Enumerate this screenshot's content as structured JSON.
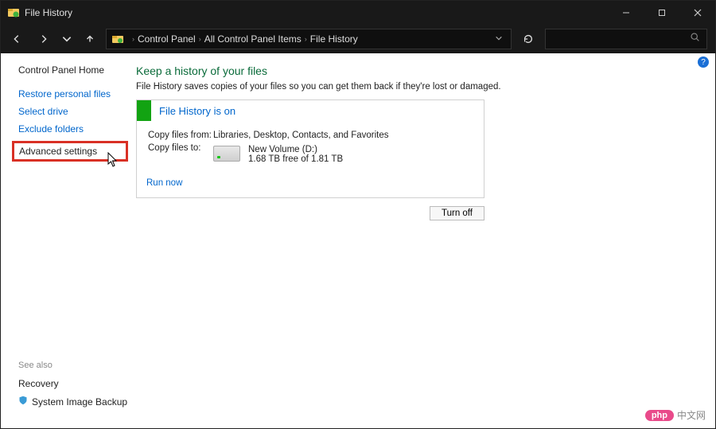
{
  "titlebar": {
    "title": "File History"
  },
  "nav": {
    "crumbs": {
      "a": "Control Panel",
      "b": "All Control Panel Items",
      "c": "File History"
    }
  },
  "sidebar": {
    "home": "Control Panel Home",
    "links": {
      "restore": "Restore personal files",
      "select_drive": "Select drive",
      "exclude": "Exclude folders",
      "advanced": "Advanced settings"
    },
    "seealso": {
      "header": "See also",
      "recovery": "Recovery",
      "sib": "System Image Backup"
    }
  },
  "main": {
    "heading": "Keep a history of your files",
    "desc": "File History saves copies of your files so you can get them back if they're lost or damaged.",
    "status_title": "File History is on",
    "copy_from_label": "Copy files from:",
    "copy_from_value": "Libraries, Desktop, Contacts, and Favorites",
    "copy_to_label": "Copy files to:",
    "drive_name": "New Volume (D:)",
    "drive_free": "1.68 TB free of 1.81 TB",
    "run_now": "Run now",
    "turn_off": "Turn off"
  },
  "watermark": {
    "pill": "php",
    "text": "中文网"
  }
}
